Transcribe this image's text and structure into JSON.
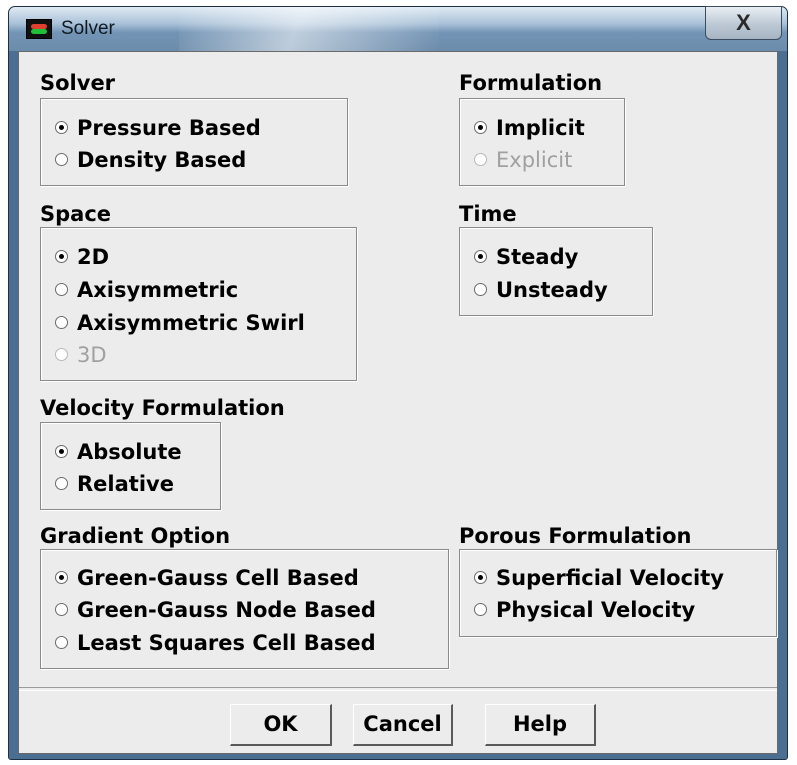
{
  "window": {
    "title": "Solver",
    "close_label": "X"
  },
  "solver": {
    "label": "Solver",
    "options": [
      "Pressure Based",
      "Density Based"
    ],
    "selected": "Pressure Based"
  },
  "formulation": {
    "label": "Formulation",
    "options": [
      "Implicit",
      "Explicit"
    ],
    "selected": "Implicit",
    "disabled": [
      "Explicit"
    ]
  },
  "space": {
    "label": "Space",
    "options": [
      "2D",
      "Axisymmetric",
      "Axisymmetric Swirl",
      "3D"
    ],
    "selected": "2D",
    "disabled": [
      "3D"
    ]
  },
  "time": {
    "label": "Time",
    "options": [
      "Steady",
      "Unsteady"
    ],
    "selected": "Steady"
  },
  "velocity": {
    "label": "Velocity Formulation",
    "options": [
      "Absolute",
      "Relative"
    ],
    "selected": "Absolute"
  },
  "gradient": {
    "label": "Gradient Option",
    "options": [
      "Green-Gauss Cell Based",
      "Green-Gauss Node Based",
      "Least Squares Cell Based"
    ],
    "selected": "Green-Gauss Cell Based"
  },
  "porous": {
    "label": "Porous Formulation",
    "options": [
      "Superficial Velocity",
      "Physical Velocity"
    ],
    "selected": "Superficial Velocity"
  },
  "buttons": {
    "ok": "OK",
    "cancel": "Cancel",
    "help": "Help"
  },
  "colors": {
    "title_bar": "#7394b5",
    "dialog_bg": "#ececec",
    "disabled_text": "#a0a0a0"
  },
  "icons": {
    "app": "fluent-app-icon",
    "close": "close-icon"
  }
}
